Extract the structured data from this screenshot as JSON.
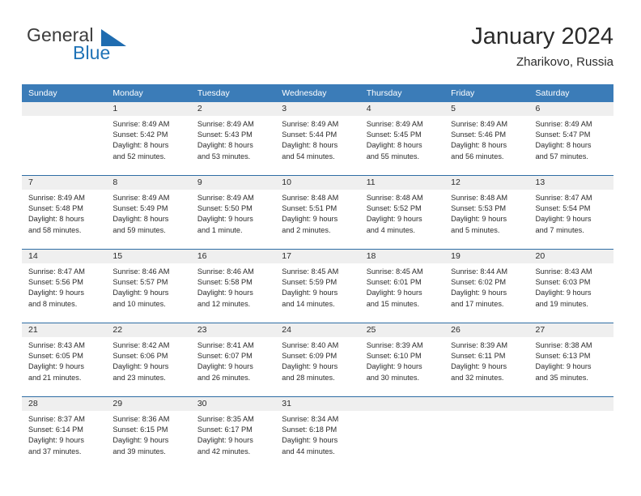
{
  "brand": {
    "word_one": "General",
    "word_two": "Blue",
    "triangle_icon": "brand-triangle-icon",
    "accent_color": "#1f6cb0"
  },
  "header": {
    "title": "January 2024",
    "subtitle": "Zharikovo, Russia"
  },
  "calendar": {
    "header_bg": "#3b7cb8",
    "row_divider": "#2e6da4",
    "day_band_bg": "#efefef",
    "weekdays": [
      "Sunday",
      "Monday",
      "Tuesday",
      "Wednesday",
      "Thursday",
      "Friday",
      "Saturday"
    ],
    "weeks": [
      [
        {
          "day": "",
          "empty": true,
          "sunrise": "",
          "sunset": "",
          "daylight_line1": "",
          "daylight_line2": ""
        },
        {
          "day": "1",
          "sunrise": "Sunrise: 8:49 AM",
          "sunset": "Sunset: 5:42 PM",
          "daylight_line1": "Daylight: 8 hours",
          "daylight_line2": "and 52 minutes."
        },
        {
          "day": "2",
          "sunrise": "Sunrise: 8:49 AM",
          "sunset": "Sunset: 5:43 PM",
          "daylight_line1": "Daylight: 8 hours",
          "daylight_line2": "and 53 minutes."
        },
        {
          "day": "3",
          "sunrise": "Sunrise: 8:49 AM",
          "sunset": "Sunset: 5:44 PM",
          "daylight_line1": "Daylight: 8 hours",
          "daylight_line2": "and 54 minutes."
        },
        {
          "day": "4",
          "sunrise": "Sunrise: 8:49 AM",
          "sunset": "Sunset: 5:45 PM",
          "daylight_line1": "Daylight: 8 hours",
          "daylight_line2": "and 55 minutes."
        },
        {
          "day": "5",
          "sunrise": "Sunrise: 8:49 AM",
          "sunset": "Sunset: 5:46 PM",
          "daylight_line1": "Daylight: 8 hours",
          "daylight_line2": "and 56 minutes."
        },
        {
          "day": "6",
          "sunrise": "Sunrise: 8:49 AM",
          "sunset": "Sunset: 5:47 PM",
          "daylight_line1": "Daylight: 8 hours",
          "daylight_line2": "and 57 minutes."
        }
      ],
      [
        {
          "day": "7",
          "sunrise": "Sunrise: 8:49 AM",
          "sunset": "Sunset: 5:48 PM",
          "daylight_line1": "Daylight: 8 hours",
          "daylight_line2": "and 58 minutes."
        },
        {
          "day": "8",
          "sunrise": "Sunrise: 8:49 AM",
          "sunset": "Sunset: 5:49 PM",
          "daylight_line1": "Daylight: 8 hours",
          "daylight_line2": "and 59 minutes."
        },
        {
          "day": "9",
          "sunrise": "Sunrise: 8:49 AM",
          "sunset": "Sunset: 5:50 PM",
          "daylight_line1": "Daylight: 9 hours",
          "daylight_line2": "and 1 minute."
        },
        {
          "day": "10",
          "sunrise": "Sunrise: 8:48 AM",
          "sunset": "Sunset: 5:51 PM",
          "daylight_line1": "Daylight: 9 hours",
          "daylight_line2": "and 2 minutes."
        },
        {
          "day": "11",
          "sunrise": "Sunrise: 8:48 AM",
          "sunset": "Sunset: 5:52 PM",
          "daylight_line1": "Daylight: 9 hours",
          "daylight_line2": "and 4 minutes."
        },
        {
          "day": "12",
          "sunrise": "Sunrise: 8:48 AM",
          "sunset": "Sunset: 5:53 PM",
          "daylight_line1": "Daylight: 9 hours",
          "daylight_line2": "and 5 minutes."
        },
        {
          "day": "13",
          "sunrise": "Sunrise: 8:47 AM",
          "sunset": "Sunset: 5:54 PM",
          "daylight_line1": "Daylight: 9 hours",
          "daylight_line2": "and 7 minutes."
        }
      ],
      [
        {
          "day": "14",
          "sunrise": "Sunrise: 8:47 AM",
          "sunset": "Sunset: 5:56 PM",
          "daylight_line1": "Daylight: 9 hours",
          "daylight_line2": "and 8 minutes."
        },
        {
          "day": "15",
          "sunrise": "Sunrise: 8:46 AM",
          "sunset": "Sunset: 5:57 PM",
          "daylight_line1": "Daylight: 9 hours",
          "daylight_line2": "and 10 minutes."
        },
        {
          "day": "16",
          "sunrise": "Sunrise: 8:46 AM",
          "sunset": "Sunset: 5:58 PM",
          "daylight_line1": "Daylight: 9 hours",
          "daylight_line2": "and 12 minutes."
        },
        {
          "day": "17",
          "sunrise": "Sunrise: 8:45 AM",
          "sunset": "Sunset: 5:59 PM",
          "daylight_line1": "Daylight: 9 hours",
          "daylight_line2": "and 14 minutes."
        },
        {
          "day": "18",
          "sunrise": "Sunrise: 8:45 AM",
          "sunset": "Sunset: 6:01 PM",
          "daylight_line1": "Daylight: 9 hours",
          "daylight_line2": "and 15 minutes."
        },
        {
          "day": "19",
          "sunrise": "Sunrise: 8:44 AM",
          "sunset": "Sunset: 6:02 PM",
          "daylight_line1": "Daylight: 9 hours",
          "daylight_line2": "and 17 minutes."
        },
        {
          "day": "20",
          "sunrise": "Sunrise: 8:43 AM",
          "sunset": "Sunset: 6:03 PM",
          "daylight_line1": "Daylight: 9 hours",
          "daylight_line2": "and 19 minutes."
        }
      ],
      [
        {
          "day": "21",
          "sunrise": "Sunrise: 8:43 AM",
          "sunset": "Sunset: 6:05 PM",
          "daylight_line1": "Daylight: 9 hours",
          "daylight_line2": "and 21 minutes."
        },
        {
          "day": "22",
          "sunrise": "Sunrise: 8:42 AM",
          "sunset": "Sunset: 6:06 PM",
          "daylight_line1": "Daylight: 9 hours",
          "daylight_line2": "and 23 minutes."
        },
        {
          "day": "23",
          "sunrise": "Sunrise: 8:41 AM",
          "sunset": "Sunset: 6:07 PM",
          "daylight_line1": "Daylight: 9 hours",
          "daylight_line2": "and 26 minutes."
        },
        {
          "day": "24",
          "sunrise": "Sunrise: 8:40 AM",
          "sunset": "Sunset: 6:09 PM",
          "daylight_line1": "Daylight: 9 hours",
          "daylight_line2": "and 28 minutes."
        },
        {
          "day": "25",
          "sunrise": "Sunrise: 8:39 AM",
          "sunset": "Sunset: 6:10 PM",
          "daylight_line1": "Daylight: 9 hours",
          "daylight_line2": "and 30 minutes."
        },
        {
          "day": "26",
          "sunrise": "Sunrise: 8:39 AM",
          "sunset": "Sunset: 6:11 PM",
          "daylight_line1": "Daylight: 9 hours",
          "daylight_line2": "and 32 minutes."
        },
        {
          "day": "27",
          "sunrise": "Sunrise: 8:38 AM",
          "sunset": "Sunset: 6:13 PM",
          "daylight_line1": "Daylight: 9 hours",
          "daylight_line2": "and 35 minutes."
        }
      ],
      [
        {
          "day": "28",
          "sunrise": "Sunrise: 8:37 AM",
          "sunset": "Sunset: 6:14 PM",
          "daylight_line1": "Daylight: 9 hours",
          "daylight_line2": "and 37 minutes."
        },
        {
          "day": "29",
          "sunrise": "Sunrise: 8:36 AM",
          "sunset": "Sunset: 6:15 PM",
          "daylight_line1": "Daylight: 9 hours",
          "daylight_line2": "and 39 minutes."
        },
        {
          "day": "30",
          "sunrise": "Sunrise: 8:35 AM",
          "sunset": "Sunset: 6:17 PM",
          "daylight_line1": "Daylight: 9 hours",
          "daylight_line2": "and 42 minutes."
        },
        {
          "day": "31",
          "sunrise": "Sunrise: 8:34 AM",
          "sunset": "Sunset: 6:18 PM",
          "daylight_line1": "Daylight: 9 hours",
          "daylight_line2": "and 44 minutes."
        },
        {
          "day": "",
          "empty": true,
          "sunrise": "",
          "sunset": "",
          "daylight_line1": "",
          "daylight_line2": ""
        },
        {
          "day": "",
          "empty": true,
          "sunrise": "",
          "sunset": "",
          "daylight_line1": "",
          "daylight_line2": ""
        },
        {
          "day": "",
          "empty": true,
          "sunrise": "",
          "sunset": "",
          "daylight_line1": "",
          "daylight_line2": ""
        }
      ]
    ]
  }
}
